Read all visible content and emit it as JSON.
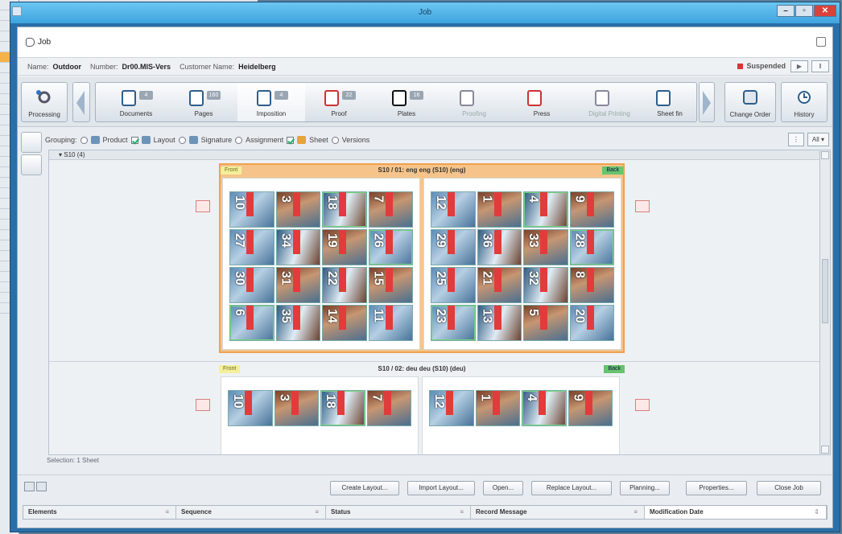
{
  "window": {
    "title": "Job"
  },
  "header": {
    "title": "Job"
  },
  "info": {
    "name_label": "Name:",
    "name_value": "Outdoor",
    "number_label": "Number:",
    "number_value": "Dr00.MIS-Vers",
    "customer_label": "Customer Name:",
    "customer_value": "Heidelberg",
    "status": "Suspended"
  },
  "toolbar": {
    "processing": "Processing",
    "change_order": "Change Order",
    "history": "History",
    "steps": [
      {
        "label": "Documents",
        "count": "4"
      },
      {
        "label": "Pages",
        "count": "160"
      },
      {
        "label": "Imposition",
        "count": "4"
      },
      {
        "label": "Proof",
        "count": "22"
      },
      {
        "label": "Plates",
        "count": "16"
      },
      {
        "label": "Proofing",
        "count": ""
      },
      {
        "label": "Press",
        "count": ""
      },
      {
        "label": "Digital Printing",
        "count": ""
      },
      {
        "label": "Sheet fin",
        "count": ""
      }
    ]
  },
  "grouping": {
    "label": "Grouping:",
    "product": "Product",
    "layout": "Layout",
    "signature": "Signature",
    "assignment": "Assignment",
    "sheet": "Sheet",
    "versions": "Versions",
    "view_all": "All"
  },
  "tree": {
    "node": "S10 (4)"
  },
  "sheets": [
    {
      "title": "S10 / 01: eng eng (S10) (eng)",
      "front": "Front",
      "back": "Back",
      "front_pages": [
        "10",
        "3",
        "18",
        "7",
        "27",
        "34",
        "19",
        "26",
        "30",
        "31",
        "22",
        "15",
        "6",
        "35",
        "14",
        "11"
      ],
      "back_pages": [
        "12",
        "1",
        "4",
        "9",
        "29",
        "36",
        "33",
        "28",
        "25",
        "21",
        "32",
        "8",
        "23",
        "13",
        "5",
        "20"
      ]
    },
    {
      "title": "S10 / 02: deu deu (S10) (deu)",
      "front": "Front",
      "back": "Back",
      "front_pages": [
        "10",
        "3",
        "18",
        "7"
      ],
      "back_pages": [
        "12",
        "1",
        "4",
        "9"
      ]
    }
  ],
  "selection": "Selection: 1 Sheet",
  "buttons": {
    "create_layout": "Create Layout...",
    "import_layout": "Import Layout...",
    "open": "Open...",
    "replace_layout": "Replace Layout...",
    "planning": "Planning...",
    "properties": "Properties...",
    "close_job": "Close Job"
  },
  "table": {
    "columns": [
      "Elements",
      "Sequence",
      "Status",
      "Record Message",
      "Modification Date"
    ]
  }
}
